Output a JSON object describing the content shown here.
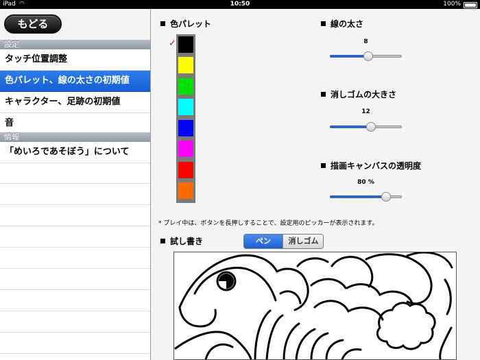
{
  "status": {
    "carrier": "iPad",
    "time": "10:50",
    "battery": "100%"
  },
  "back_label": "もどる",
  "sidebar": {
    "section1": "設定",
    "items1": [
      {
        "label": "タッチ位置調整",
        "selected": false
      },
      {
        "label": "色パレット、線の太さの初期値",
        "selected": true
      },
      {
        "label": "キャラクター、足跡の初期値",
        "selected": false
      },
      {
        "label": "音",
        "selected": false
      }
    ],
    "section2": "情報",
    "items2": [
      {
        "label": "「めいろであそぼう」について"
      }
    ]
  },
  "main": {
    "palette_title": "色パレット",
    "palette": [
      "#000000",
      "#ffff00",
      "#00e000",
      "#00ffff",
      "#0000ff",
      "#ff00ff",
      "#ff0000",
      "#ff6a00"
    ],
    "selected_index": 0,
    "selected_mark": "✓",
    "line_width": {
      "title": "線の太さ",
      "value": "8",
      "fraction": 0.53
    },
    "eraser_size": {
      "title": "消しゴムの大きさ",
      "value": "12",
      "fraction": 0.57
    },
    "canvas_opacity": {
      "title": "描画キャンバスの透明度",
      "value": "80 %",
      "fraction": 0.78
    },
    "note": "* プレイ中は、ボタンを長押しすることで、設定用のピッカーが表示されます。",
    "test_title": "試し書き",
    "pen_label": "ペン",
    "eraser_label": "消しゴム"
  }
}
